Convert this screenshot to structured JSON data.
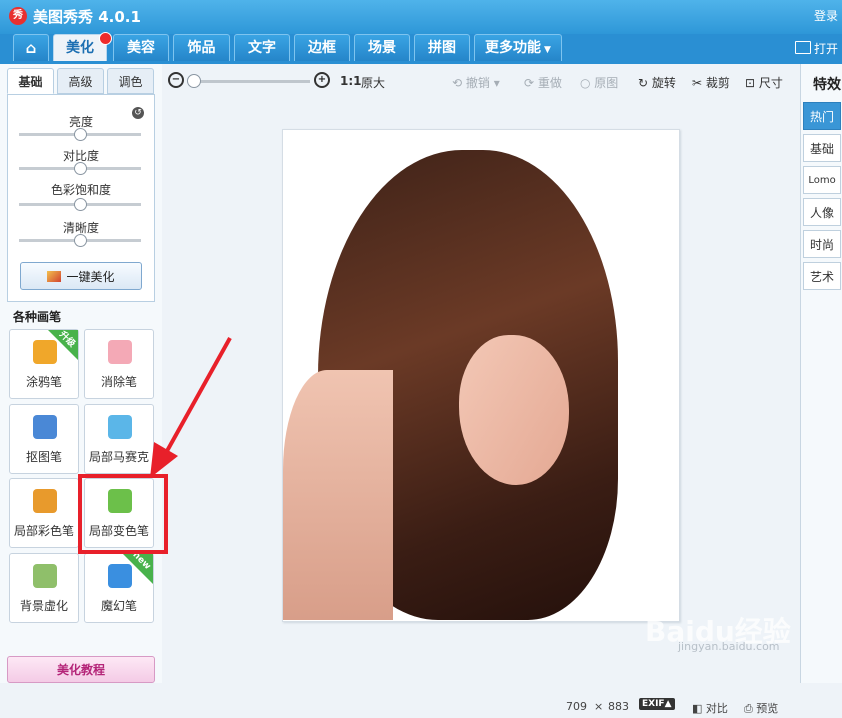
{
  "app": {
    "title": "美图秀秀 4.0.1",
    "logo_text": "秀",
    "login": "登录"
  },
  "tabs": [
    {
      "label": "⌂"
    },
    {
      "label": "美化"
    },
    {
      "label": "美容"
    },
    {
      "label": "饰品"
    },
    {
      "label": "文字"
    },
    {
      "label": "边框"
    },
    {
      "label": "场景"
    },
    {
      "label": "拼图"
    },
    {
      "label": "更多功能"
    }
  ],
  "open_label": "打开",
  "subtabs": [
    "基础",
    "高级",
    "调色"
  ],
  "sliders": [
    {
      "label": "亮度",
      "level": 0.5
    },
    {
      "label": "对比度",
      "level": 0.5
    },
    {
      "label": "色彩饱和度",
      "level": 0.5
    },
    {
      "label": "清晰度",
      "level": 0.5
    }
  ],
  "onekey_label": "一键美化",
  "brushes_title": "各种画笔",
  "tools": [
    {
      "label": "涂鸦笔",
      "ribbon": "升级",
      "icon": "brush-icon",
      "color": "#f0a72a"
    },
    {
      "label": "消除笔",
      "ribbon": "",
      "icon": "eraser-icon",
      "color": "#f4a9b6"
    },
    {
      "label": "抠图笔",
      "ribbon": "",
      "icon": "pen-icon",
      "color": "#4a88d6"
    },
    {
      "label": "局部马赛克",
      "ribbon": "",
      "icon": "mosaic-icon",
      "color": "#5bb6e8"
    },
    {
      "label": "局部彩色笔",
      "ribbon": "",
      "icon": "paintbrush-icon",
      "color": "#e89a2c"
    },
    {
      "label": "局部变色笔",
      "ribbon": "",
      "icon": "color-change-icon",
      "color": "#6cc04a"
    },
    {
      "label": "背景虚化",
      "ribbon": "",
      "icon": "blur-icon",
      "color": "#8fbf6a"
    },
    {
      "label": "魔幻笔",
      "ribbon": "new",
      "icon": "magic-pen-icon",
      "color": "#3a8fe0"
    }
  ],
  "tutorial_label": "美化教程",
  "toolbar": {
    "zoom_level": 0,
    "ratio": "1:1",
    "original_size": "原大",
    "undo": "撤销",
    "redo": "重做",
    "original": "原图",
    "rotate": "旋转",
    "crop": "裁剪",
    "size": "尺寸"
  },
  "status": {
    "width": "709",
    "times": "×",
    "height": "883",
    "exif": "EXIF▲",
    "compare": "对比",
    "preview": "预览"
  },
  "effects": {
    "title": "特效",
    "items": [
      "热门",
      "基础",
      "Lomo",
      "人像",
      "时尚",
      "艺术"
    ]
  },
  "watermark": {
    "main": "Baidu经验",
    "sub": "jingyan.baidu.com"
  },
  "colors": {
    "titlebar": "#2e97d8",
    "highlight": "#e8202a"
  }
}
